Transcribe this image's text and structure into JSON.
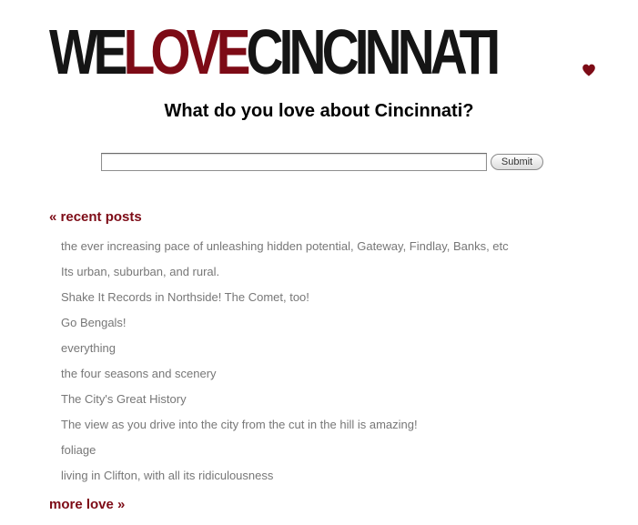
{
  "header": {
    "logo": {
      "part_we": "WE",
      "part_love": "LOVE",
      "part_city": "CINCINNATI",
      "heart_icon": "heart-icon",
      "colors": {
        "dark": "#151515",
        "accent": "#7d0b16"
      }
    },
    "tagline": "What do you love about Cincinnati?"
  },
  "form": {
    "input_value": "",
    "submit_label": "Submit"
  },
  "recent": {
    "heading": "« recent posts",
    "posts": [
      "the ever increasing pace of unleashing hidden potential, Gateway, Findlay, Banks, etc",
      "Its urban, suburban, and rural.",
      "Shake It Records in Northside! The Comet, too!",
      "Go Bengals!",
      "everything",
      "the four seasons and scenery",
      "The City's Great History",
      "The view as you drive into the city from the cut in the hill is amazing!",
      "foliage",
      "living in Clifton, with all its ridiculousness"
    ],
    "more_label": "more love »"
  }
}
